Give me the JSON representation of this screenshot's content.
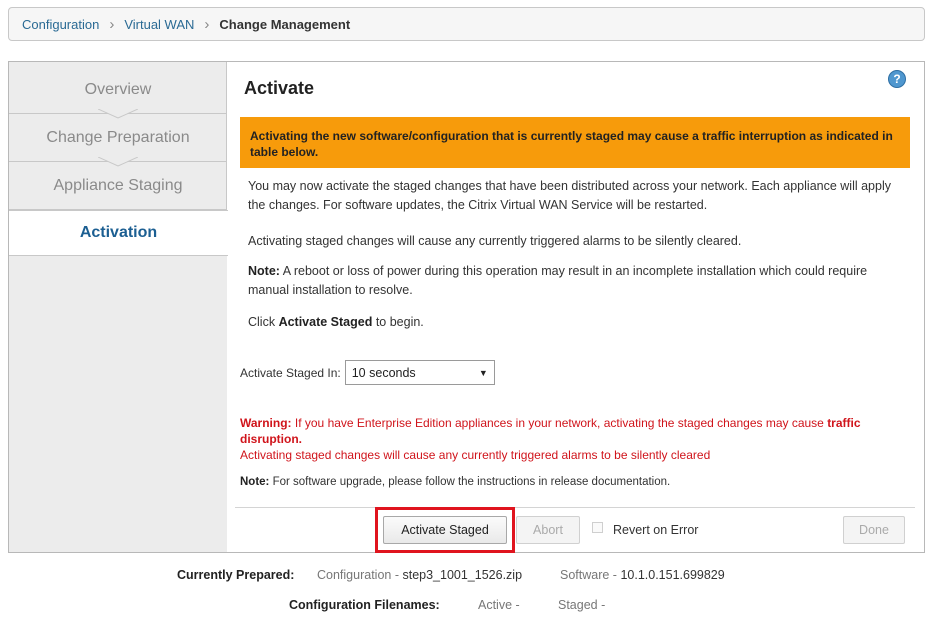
{
  "breadcrumb": {
    "items": [
      "Configuration",
      "Virtual WAN"
    ],
    "current": "Change Management"
  },
  "steps": [
    "Overview",
    "Change Preparation",
    "Appliance Staging",
    "Activation"
  ],
  "active_step": "Activation",
  "title": "Activate",
  "help_icon": "?",
  "banner": "Activating the new software/configuration that is currently staged may cause a traffic interruption as indicated in table below.",
  "paragraphs": {
    "p1": "You may now activate the staged changes that have been distributed across your network. Each appliance will apply the changes. For software updates, the Citrix Virtual WAN Service will be restarted.",
    "p2": "Activating staged changes will cause any currently triggered alarms to be silently cleared.",
    "p3_bold": "Note:",
    "p3": " A reboot or loss of power during this operation may result in an incomplete installation which could require manual installation to resolve.",
    "p4_pre": "Click ",
    "p4_bold": "Activate Staged",
    "p4_post": " to begin."
  },
  "activate_in": {
    "label": "Activate Staged In:",
    "selected": "10 seconds"
  },
  "warning": {
    "bold": "Warning:",
    "text": " If you have Enterprise Edition appliances in your network, activating the staged changes may cause ",
    "bold2": "traffic disruption.",
    "line2": "Activating staged changes will cause any currently triggered alarms to be silently cleared"
  },
  "note": {
    "bold": "Note:",
    "text": " For software upgrade, please follow the instructions in release documentation."
  },
  "buttons": {
    "activate": "Activate Staged",
    "abort": "Abort",
    "revert": "Revert on Error",
    "done": "Done"
  },
  "summary": {
    "prepared_label": "Currently Prepared:",
    "config_label": "Configuration - ",
    "config_value": "step3_1001_1526.zip",
    "software_label": "Software - ",
    "software_value": "10.1.0.151.699829",
    "filenames_label": "Configuration Filenames:",
    "active": "Active -",
    "staged": "Staged -"
  },
  "colors": {
    "banner": "#f79b0b",
    "warning": "#d0141b",
    "active_step": "#1c5f92",
    "highlight": "#e0141e"
  }
}
